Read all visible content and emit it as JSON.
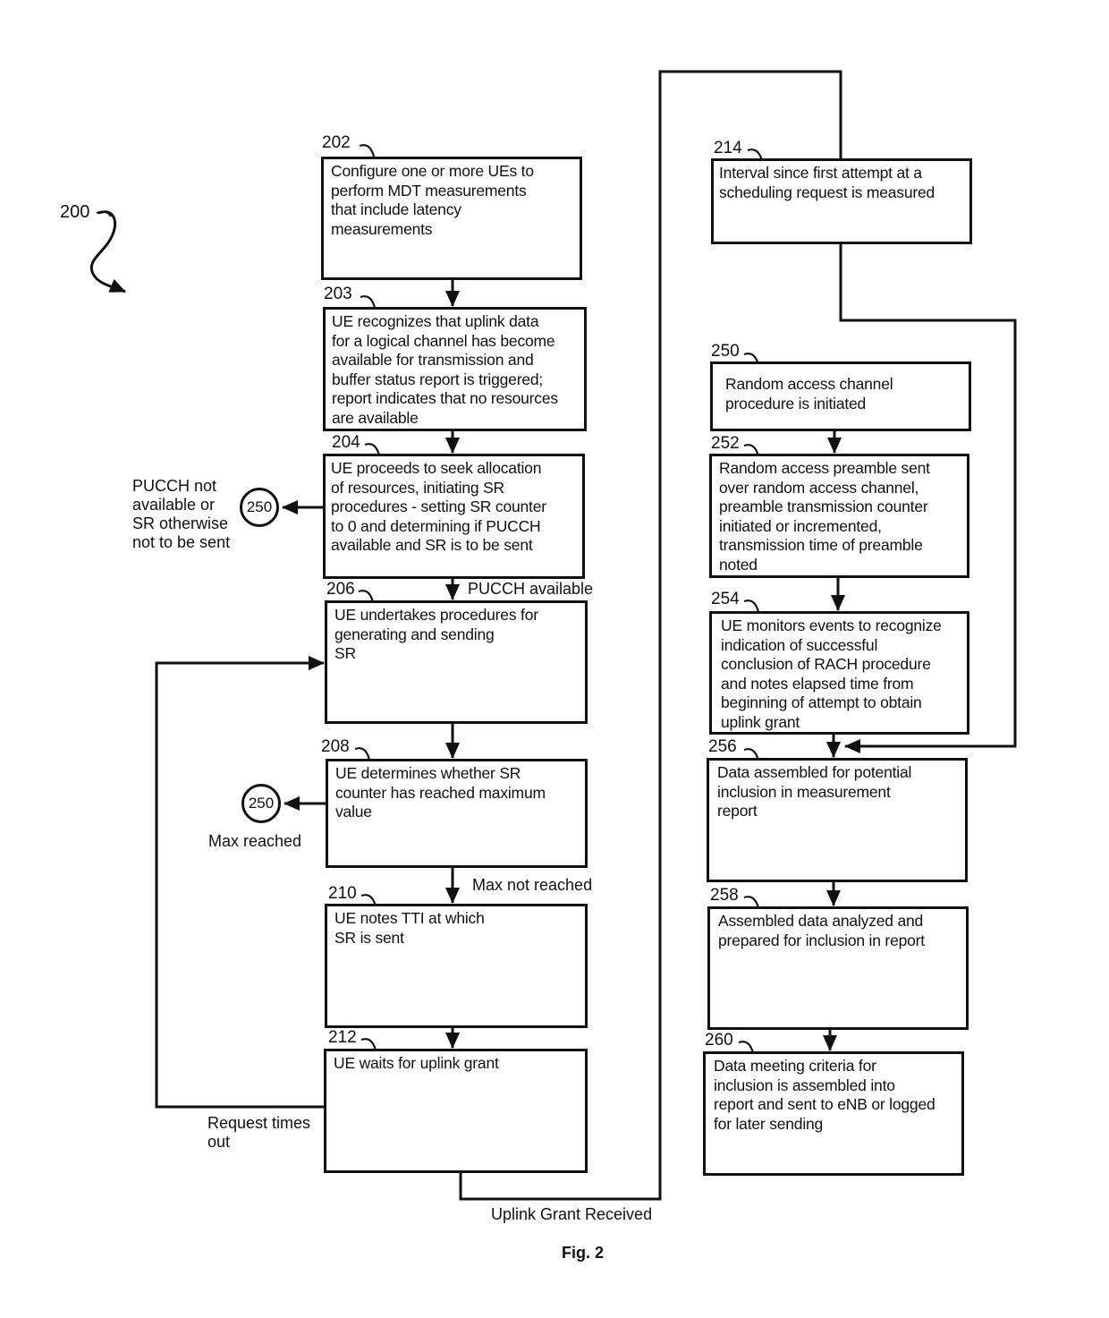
{
  "figure": {
    "id": "200",
    "caption": "Fig. 2"
  },
  "steps": {
    "s202": {
      "ref": "202",
      "text": "Configure one or more UEs to\nperform MDT measurements\nthat include latency\nmeasurements"
    },
    "s203": {
      "ref": "203",
      "text": "UE recognizes that uplink data\nfor a logical channel has become\navailable for transmission and\nbuffer status report is triggered;\nreport indicates that no resources\nare available"
    },
    "s204": {
      "ref": "204",
      "text": "UE proceeds to seek allocation\nof resources, initiating SR\nprocedures - setting SR counter\nto 0 and determining if PUCCH\navailable and SR is to be sent"
    },
    "s206": {
      "ref": "206",
      "text": "UE undertakes procedures for\ngenerating and sending\nSR"
    },
    "s208": {
      "ref": "208",
      "text": "UE determines whether SR\ncounter has reached maximum\nvalue"
    },
    "s210": {
      "ref": "210",
      "text": "UE notes TTI at which\nSR is sent"
    },
    "s212": {
      "ref": "212",
      "text": "UE waits for uplink grant"
    },
    "s214": {
      "ref": "214",
      "text": "Interval since first attempt at a\nscheduling request is measured"
    },
    "s250": {
      "ref": "250",
      "text": "Random access channel\nprocedure is initiated"
    },
    "s252": {
      "ref": "252",
      "text": "Random access preamble sent\nover random access channel,\npreamble transmission counter\ninitiated or incremented,\ntransmission time of preamble\nnoted"
    },
    "s254": {
      "ref": "254",
      "text": "UE monitors events to recognize\nindication of successful\nconclusion of RACH procedure\nand notes elapsed time from\nbeginning of attempt to obtain\nuplink grant"
    },
    "s256": {
      "ref": "256",
      "text": "Data assembled for potential\ninclusion in measurement\nreport"
    },
    "s258": {
      "ref": "258",
      "text": "Assembled data analyzed and\nprepared for inclusion in report"
    },
    "s260": {
      "ref": "260",
      "text": "Data meeting criteria for\ninclusion is assembled into\nreport and sent to eNB or logged\nfor later sending"
    }
  },
  "connectors": {
    "c1": "250",
    "c2": "250"
  },
  "edge_labels": {
    "pucch_not_available": "PUCCH not\navailable or\nSR otherwise\nnot to be sent",
    "pucch_available": "PUCCH available",
    "max_reached": "Max reached",
    "max_not_reached": "Max not reached",
    "request_times_out": "Request times\nout",
    "uplink_grant_received": "Uplink Grant Received"
  }
}
